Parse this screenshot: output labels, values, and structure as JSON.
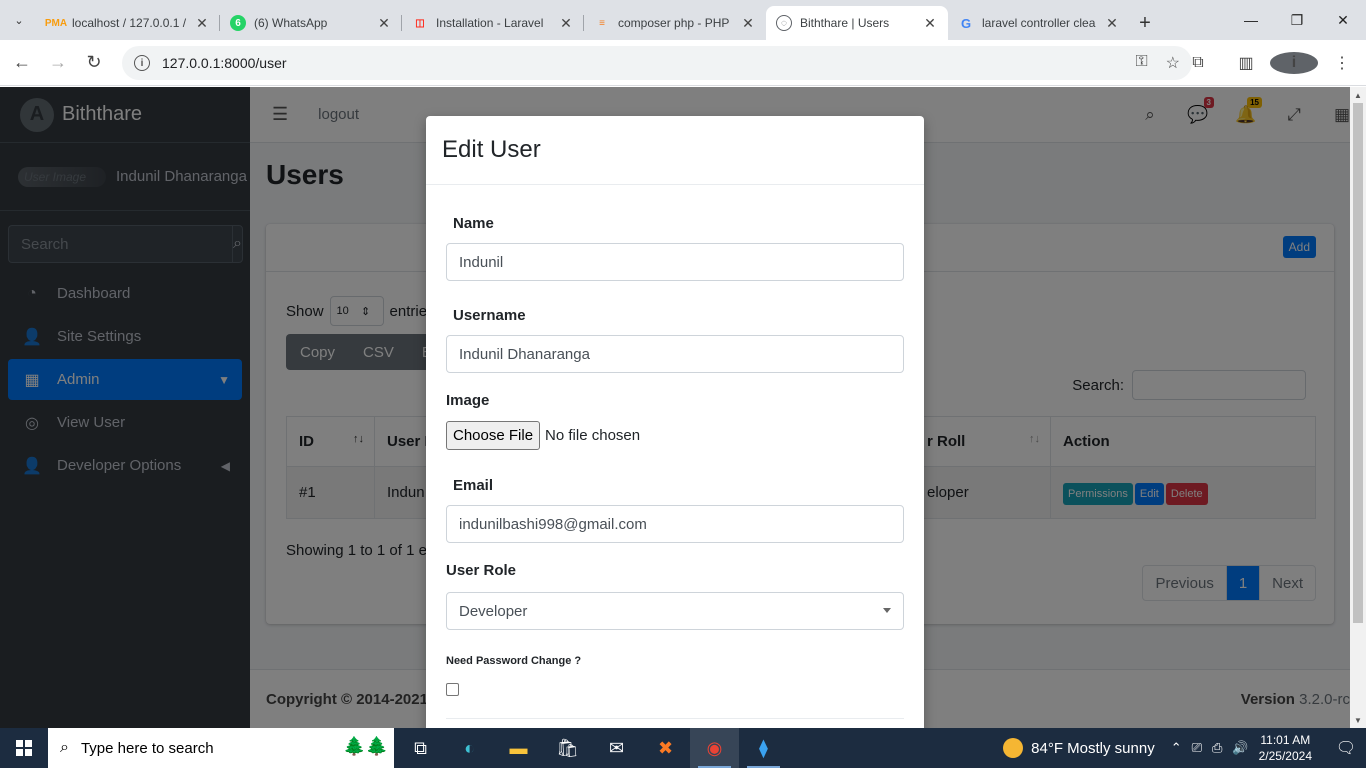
{
  "browser": {
    "tabs": [
      {
        "title": "localhost / 127.0.0.1 /",
        "favicon": "phpmyadmin-icon",
        "color": "#f89c0e"
      },
      {
        "title": "(6) WhatsApp",
        "favicon": "whatsapp-icon",
        "color": "#25d366"
      },
      {
        "title": "Installation - Laravel",
        "favicon": "laravel-icon",
        "color": "#ff2d20"
      },
      {
        "title": "composer php - PHP",
        "favicon": "stackoverflow-icon",
        "color": "#f48024"
      },
      {
        "title": "Biththare | Users",
        "favicon": "globe-icon",
        "color": "#5f6368",
        "active": true
      },
      {
        "title": "laravel controller clea",
        "favicon": "google-icon",
        "color": "#4285f4"
      }
    ],
    "url": "127.0.0.1:8000/user"
  },
  "sidebar": {
    "brand": "Biththare",
    "user_image_alt": "User Image",
    "user_name": "Indunil Dhanaranga",
    "search_placeholder": "Search",
    "items": [
      {
        "label": "Dashboard",
        "icon": "tachometer-icon"
      },
      {
        "label": "Site Settings",
        "icon": "user-icon"
      },
      {
        "label": "Admin",
        "icon": "grid-icon",
        "active": true
      },
      {
        "label": "View User",
        "icon": "circle-icon"
      },
      {
        "label": "Developer Options",
        "icon": "user-icon"
      }
    ]
  },
  "topnav": {
    "logout": "logout",
    "messages_count": "3",
    "notifications_count": "15"
  },
  "page": {
    "title": "Users",
    "add_label": "Add",
    "show_label": "Show",
    "entries_value": "10",
    "entries_label": "entrie",
    "export_buttons": [
      "Copy",
      "CSV",
      "Exc"
    ],
    "search_label": "Search:",
    "table": {
      "headers": [
        "ID",
        "User I",
        "r Roll",
        "Action"
      ],
      "rows": [
        {
          "id": "#1",
          "user": "Indun",
          "role": "eloper"
        }
      ],
      "actions": [
        "Permissions",
        "Edit",
        "Delete"
      ]
    },
    "showing": "Showing 1 to 1 of 1 en",
    "pager": {
      "previous": "Previous",
      "current": "1",
      "next": "Next"
    },
    "footer_copyright": "Copyright © 2014-2021",
    "footer_version_label": "Version",
    "footer_version": "3.2.0-rc"
  },
  "modal": {
    "title": "Edit User",
    "name_label": "Name",
    "name_value": "Indunil",
    "username_label": "Username",
    "username_value": "Indunil Dhanaranga",
    "image_label": "Image",
    "choose_file": "Choose File",
    "no_file": "No file chosen",
    "email_label": "Email",
    "email_value": "indunilbashi998@gmail.com",
    "role_label": "User Role",
    "role_value": "Developer",
    "password_change_label": "Need Password Change ?"
  },
  "taskbar": {
    "search_placeholder": "Type here to search",
    "weather": "84°F  Mostly sunny",
    "time": "11:01 AM",
    "date": "2/25/2024"
  },
  "colors": {
    "primary": "#007bff",
    "sidebar_bg": "#343a40",
    "permissions": "#17a2b8",
    "delete": "#dc3545",
    "messages_badge": "#dc3545",
    "notifications_badge": "#ffc107"
  }
}
